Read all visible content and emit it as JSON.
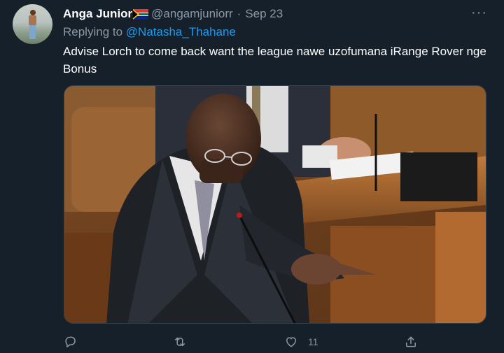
{
  "tweet": {
    "author_name": "Anga Junior",
    "author_handle": "@angamjuniorr",
    "separator": "·",
    "date": "Sep 23",
    "replying_prefix": "Replying to ",
    "replying_to": "@Natasha_Thahane",
    "text": "Advise Lorch to come back want the league nawe uzofumana iRange Rover nge Bonus",
    "more_label": "···",
    "like_count": "11"
  },
  "icons": {
    "flag": "south-africa-flag-icon",
    "reply": "reply-icon",
    "retweet": "retweet-icon",
    "like": "heart-icon",
    "share": "share-icon"
  },
  "colors": {
    "background": "#15202b",
    "text": "#ffffff",
    "muted": "#8b98a5",
    "link": "#1d9bf0",
    "border": "#38444d"
  }
}
